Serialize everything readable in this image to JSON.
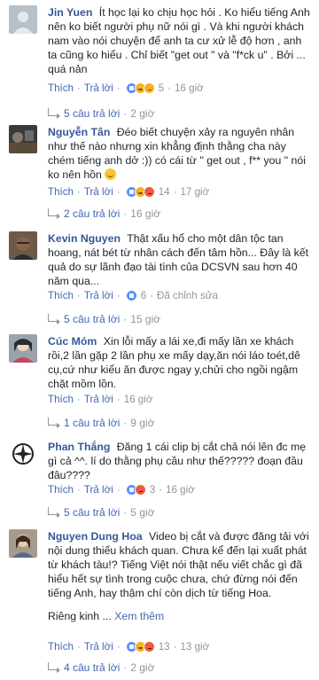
{
  "labels": {
    "like": "Thích",
    "reply": "Trả lời",
    "dot": "·"
  },
  "comments": [
    {
      "author": "Jin Yuen",
      "text": "Ít học lại ko chịu học hỏi . Ko hiểu tiếng Anh nên ko biết người phụ nữ nói gì . Và khi người khách nam vào nói chuyện để anh ta cư xử lễ độ hơn , anh ta cũng ko hiểu . Chỉ biết \"get out \" và \"f*ck u\" . Bởi ... quá nản",
      "reaction_count": "5",
      "time": "16 giờ",
      "reactions": [
        "like",
        "haha",
        "sad"
      ],
      "replies_label": "5 câu trả lời",
      "replies_time": "2 giờ"
    },
    {
      "author": "Nguyễn Tân",
      "text": "Đéo biết chuyện xảy ra nguyên nhân như thế nào nhưng xin khẳng định thằng cha này chém tiếng anh dở :)) có cái từ \" get out , f** you \" nói ko nên hồn",
      "emoji": "smile-emoji",
      "reaction_count": "14",
      "time": "17 giờ",
      "reactions": [
        "like",
        "haha",
        "angry"
      ],
      "replies_label": "2 câu trả lời",
      "replies_time": "16 giờ"
    },
    {
      "author": "Kevin Nguyen",
      "text": "Thật xấu hổ cho một dân tộc tan hoang, nát bét từ nhân cách đến tâm hồn... Đây là kết quả do sự lãnh đạo tài tình của DCSVN sau hơn 40 năm qua...",
      "reaction_count": "6",
      "edited": "Đã chỉnh sửa",
      "reactions": [
        "like"
      ],
      "replies_label": "5 câu trả lời",
      "replies_time": "15 giờ"
    },
    {
      "author": "Cúc Móm",
      "text": "Xin lỗi mấy a lái xe,đi mấy lần xe khách rồi,2 lần gặp 2 lần phụ xe mấy dạy,ăn nói láo toét,dê cụ,cứ như kiểu ăn được ngay y,chửi cho ngồi ngậm chặt mồm lồn.",
      "time": "16 giờ",
      "reactions": [],
      "replies_label": "1 câu trả lời",
      "replies_time": "9 giờ"
    },
    {
      "author": "Phan Thắng",
      "text": "Đăng 1 cái clip bị cắt chả nói lên đc mẹ gì cả ^^. lí do thằng phụ cầu như thế????? đoạn đầu đâu????",
      "reaction_count": "3",
      "time": "16 giờ",
      "reactions": [
        "like",
        "angry"
      ],
      "replies_label": "5 câu trả lời",
      "replies_time": "5 giờ"
    },
    {
      "author": "Nguyen Dung Hoa",
      "text": "Video bị cắt và được đăng tải với nội dung thiếu khách quan. Chưa kể đến lại xuất phát từ khách tàu!? Tiếng Việt nói thật nếu viết chắc gì đã hiểu hết sự tình trong cuộc chưa, chứ đừng nói đến tiếng Anh, hay thậm chí còn dịch từ tiếng Hoa.",
      "text2": "Riêng kinh ...",
      "see_more": "Xem thêm",
      "reaction_count": "13",
      "time": "13 giờ",
      "reactions": [
        "like",
        "haha",
        "angry"
      ],
      "replies_label": "4 câu trả lời",
      "replies_time": "2 giờ"
    }
  ]
}
